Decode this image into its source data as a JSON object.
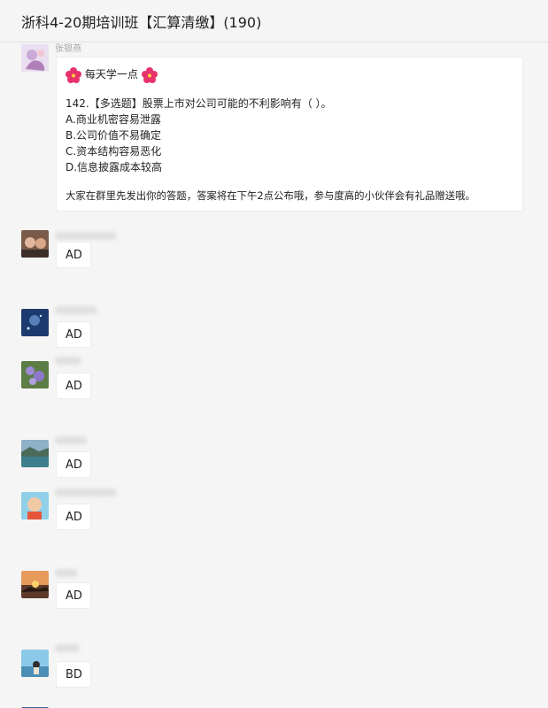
{
  "window": {
    "title": "浙科4-20期培训班【汇算清缴】(190)"
  },
  "first_message": {
    "sender": "张银燕",
    "heading": "每天学一点",
    "question": "142.【多选题】股票上市对公司可能的不利影响有（    ）。",
    "options": [
      "A.商业机密容易泄露",
      "B.公司价值不易确定",
      "C.资本结构容易恶化",
      "D.信息披露成本较高"
    ],
    "footer": "大家在群里先发出你的答题，答案将在下午2点公布哦，参与度高的小伙伴会有礼品赠送哦。"
  },
  "replies": [
    {
      "answer": "AD"
    },
    {
      "answer": "AD"
    },
    {
      "answer": "AD"
    },
    {
      "answer": "AD"
    },
    {
      "answer": "AD"
    },
    {
      "answer": "AD"
    },
    {
      "answer": "BD"
    }
  ],
  "colors": {
    "background": "#f5f5f5",
    "bubble": "#ffffff",
    "flower": "#e8326b"
  }
}
